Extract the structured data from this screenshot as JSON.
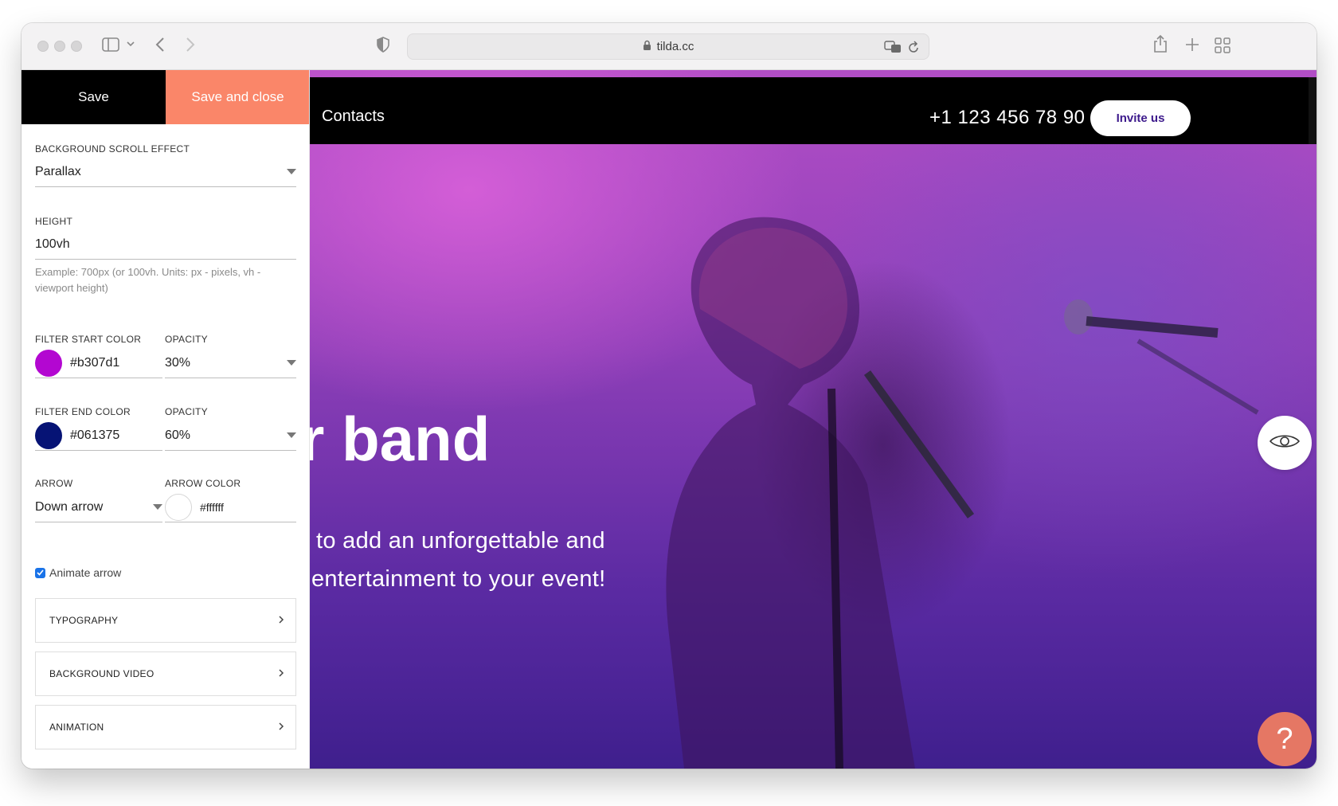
{
  "browser": {
    "url": "tilda.cc"
  },
  "panel": {
    "save_label": "Save",
    "save_close_label": "Save and close",
    "scroll_effect": {
      "label": "BACKGROUND SCROLL EFFECT",
      "value": "Parallax"
    },
    "height": {
      "label": "HEIGHT",
      "value": "100vh",
      "hint": "Example: 700px (or 100vh. Units: px - pixels, vh - viewport height)"
    },
    "filter_start": {
      "label": "FILTER START COLOR",
      "value": "#b307d1",
      "color": "#b307d1"
    },
    "filter_start_opacity": {
      "label": "OPACITY",
      "value": "30%"
    },
    "filter_end": {
      "label": "FILTER END COLOR",
      "value": "#061375",
      "color": "#061375"
    },
    "filter_end_opacity": {
      "label": "OPACITY",
      "value": "60%"
    },
    "arrow": {
      "label": "ARROW",
      "value": "Down arrow"
    },
    "arrow_color": {
      "label": "ARROW COLOR",
      "value": "#ffffff",
      "color": "#ffffff"
    },
    "animate_arrow": {
      "label": "Animate arrow",
      "checked": true
    },
    "sections": [
      "TYPOGRAPHY",
      "BACKGROUND VIDEO",
      "ANIMATION"
    ]
  },
  "site": {
    "nav_contacts": "Contacts",
    "phone": "+1 123 456 78 90",
    "invite_label": "Invite us",
    "hero_title": "r band",
    "hero_sub_line1": " to add an unforgettable and",
    "hero_sub_line2": "entertainment to your event!",
    "help_label": "?"
  }
}
